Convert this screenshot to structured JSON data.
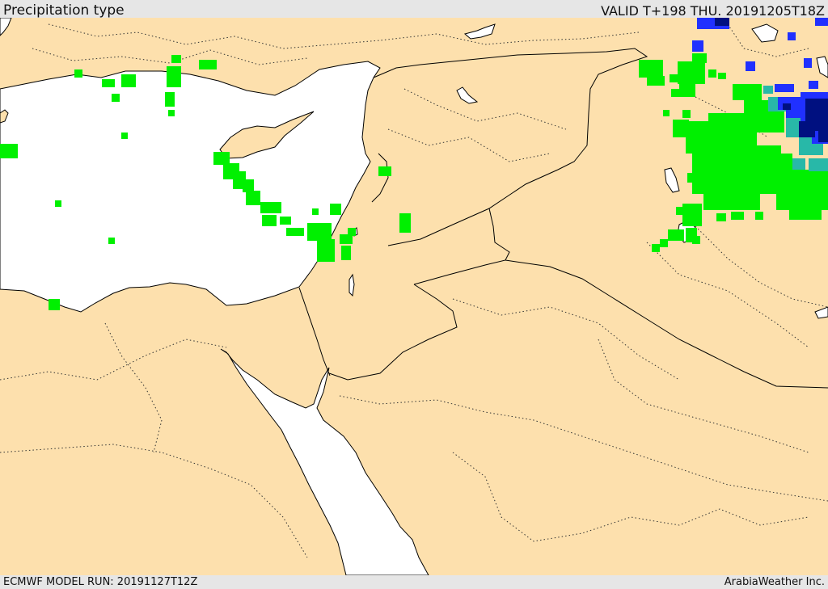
{
  "header": {
    "title": "Precipitation type",
    "valid": "VALID T+198 THU. 20191205T18Z"
  },
  "footer": {
    "model_run": "ECMWF MODEL RUN: 20191127T12Z",
    "credit": "ArabiaWeather Inc."
  },
  "colors": {
    "land": "#fde0ad",
    "water": "#ffffff",
    "rain": "#00f000",
    "snow_light": "#2030ff",
    "snow_heavy": "#001080",
    "mixed": "#28b8a8"
  }
}
